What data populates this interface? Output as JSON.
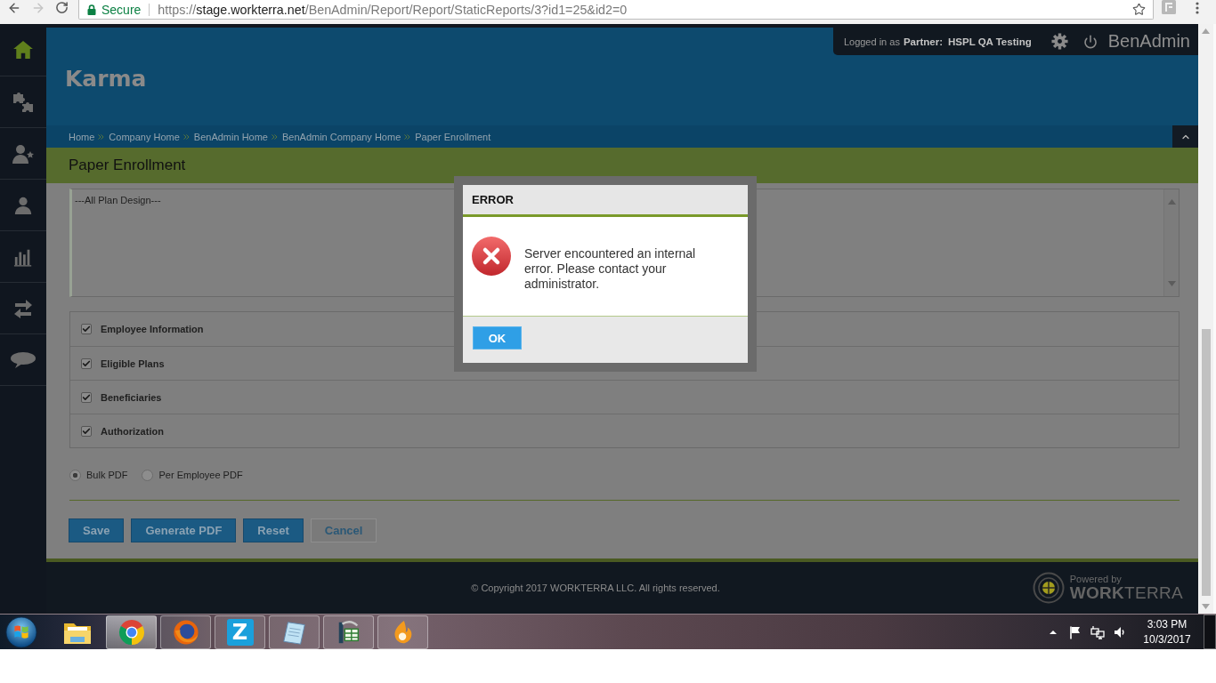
{
  "browser": {
    "back": {
      "disabled": false
    },
    "forward": {
      "disabled": true
    },
    "secure_label": "Secure",
    "url": {
      "scheme": "https://",
      "host": "stage.workterra.net",
      "path": "/BenAdmin/Report/Report/StaticReports/3?id1=25&id2=0"
    }
  },
  "sidebar": {
    "items": [
      {
        "selected": true
      },
      {
        "selected": false
      },
      {
        "selected": false
      },
      {
        "selected": false
      },
      {
        "selected": false
      },
      {
        "selected": false
      },
      {
        "selected": false
      }
    ]
  },
  "header": {
    "logo": "Karma",
    "session": {
      "prefix": "Logged in as",
      "role": "Partner:",
      "user": "HSPL QA Testing",
      "app": "BenAdmin"
    }
  },
  "breadcrumbs": [
    "Home",
    "Company Home",
    "BenAdmin Home",
    "BenAdmin Company Home",
    "Paper Enrollment"
  ],
  "page_title": "Paper Enrollment",
  "plan_list": {
    "items": [
      "---All Plan Design---"
    ]
  },
  "sections": [
    {
      "label": "Employee Information",
      "checked": true
    },
    {
      "label": "Eligible Plans",
      "checked": true
    },
    {
      "label": "Beneficiaries",
      "checked": true
    },
    {
      "label": "Authorization",
      "checked": true
    }
  ],
  "output_options": [
    {
      "label": "Bulk PDF",
      "selected": true
    },
    {
      "label": "Per Employee PDF",
      "selected": false
    }
  ],
  "buttons": [
    {
      "label": "Save",
      "kind": "primary"
    },
    {
      "label": "Generate PDF",
      "kind": "primary"
    },
    {
      "label": "Reset",
      "kind": "primary"
    },
    {
      "label": "Cancel",
      "kind": "secondary"
    }
  ],
  "footer": {
    "copyright": "© Copyright 2017 WORKTERRA LLC. All rights reserved.",
    "powered_by": "Powered by",
    "brand": "**WORK**TERRA"
  },
  "dialog": {
    "title": "ERROR",
    "message": "Server encountered an internal error. Please contact your administrator.",
    "buttons": [
      "OK"
    ]
  },
  "taskbar": {
    "apps": [
      {
        "running": false,
        "selected": false
      },
      {
        "running": true,
        "selected": true
      },
      {
        "running": true,
        "selected": false
      },
      {
        "running": true,
        "selected": false,
        "letter": "Z"
      },
      {
        "running": true,
        "selected": false
      },
      {
        "running": true,
        "selected": false
      },
      {
        "running": true,
        "selected": false
      }
    ],
    "clock": {
      "time": "3:03 PM",
      "date": "10/3/2017"
    }
  }
}
